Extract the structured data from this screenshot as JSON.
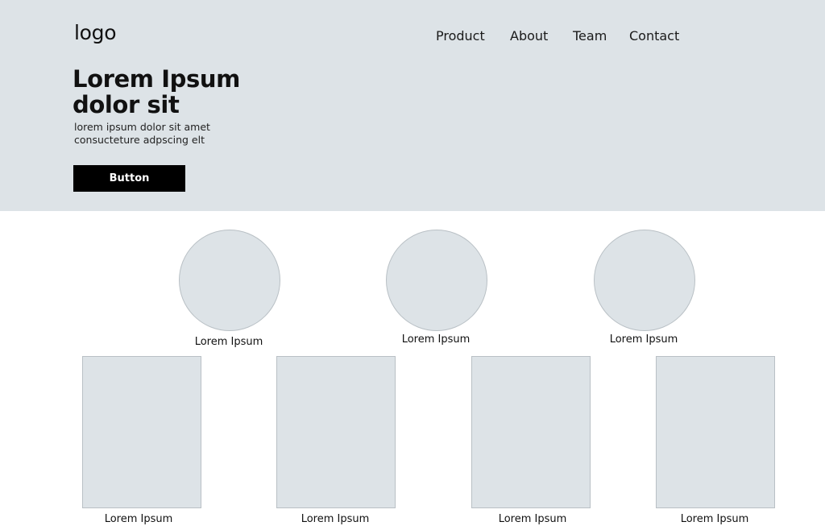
{
  "header": {
    "logo": "logo",
    "nav": [
      {
        "label": "Product"
      },
      {
        "label": "About"
      },
      {
        "label": "Team"
      },
      {
        "label": "Contact"
      }
    ]
  },
  "hero": {
    "title_lines": [
      "Lorem Ipsum",
      "dolor sit"
    ],
    "subtitle_lines": [
      "lorem ipsum dolor sit amet",
      "consucteture adpscing elt"
    ],
    "button_label": "Button"
  },
  "features": [
    {
      "label": "Lorem Ipsum"
    },
    {
      "label": "Lorem Ipsum"
    },
    {
      "label": "Lorem Ipsum"
    }
  ],
  "cards": [
    {
      "label": "Lorem Ipsum"
    },
    {
      "label": "Lorem Ipsum"
    },
    {
      "label": "Lorem Ipsum"
    },
    {
      "label": "Lorem Ipsum"
    }
  ],
  "colors": {
    "hero_background": "#dde3e7",
    "placeholder_fill": "#dde3e7",
    "placeholder_border": "#b9c0c5",
    "button_background": "#000000",
    "button_text": "#ffffff"
  }
}
